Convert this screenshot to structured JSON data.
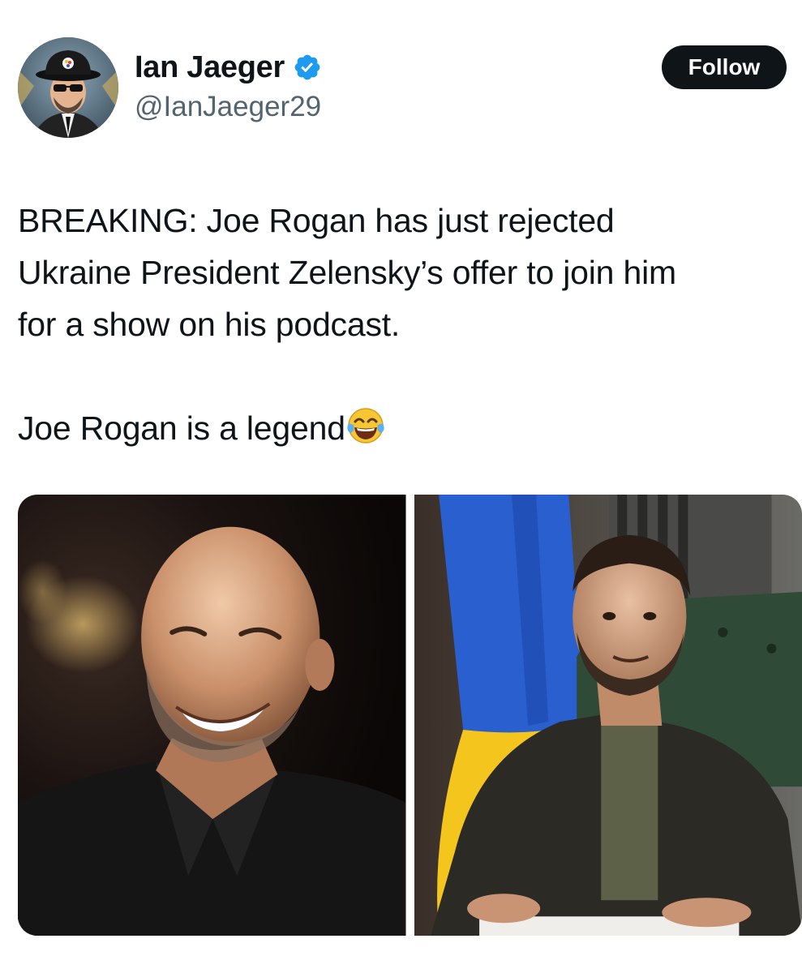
{
  "tweet": {
    "author": {
      "display_name": "Ian Jaeger",
      "handle": "@IanJaeger29",
      "verified": true,
      "avatar_icon": "profile-avatar"
    },
    "follow_label": "Follow",
    "text": {
      "line1": "BREAKING: Joe Rogan has just rejected",
      "line2": "Ukraine President Zelensky’s offer to join him",
      "line3": "for a show on his podcast.",
      "line4": "Joe Rogan is a legend"
    },
    "emoji": "face-with-tears-of-joy",
    "media": [
      {
        "icon": "photo-joe-rogan"
      },
      {
        "icon": "photo-zelensky"
      }
    ]
  },
  "colors": {
    "text": "#0f1419",
    "secondary_text": "#536471",
    "verified_blue": "#1d9bf0",
    "follow_bg": "#0f1419",
    "follow_text": "#ffffff"
  }
}
